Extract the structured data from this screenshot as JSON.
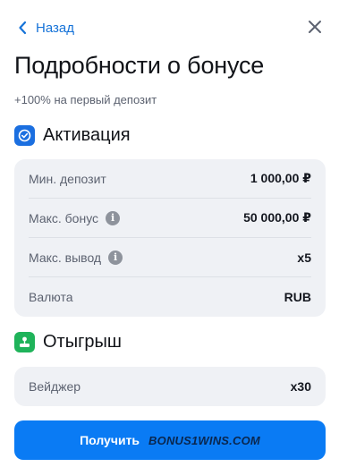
{
  "header": {
    "back_label": "Назад",
    "title": "Подробности о бонусе",
    "subtitle": "+100% на первый депозит"
  },
  "activation": {
    "title": "Активация",
    "icon": "check-badge-icon",
    "rows": [
      {
        "label": "Мин. депозит",
        "value": "1 000,00 ₽",
        "info": false
      },
      {
        "label": "Макс. бонус",
        "value": "50 000,00 ₽",
        "info": true
      },
      {
        "label": "Макс. вывод",
        "value": "x5",
        "info": true
      },
      {
        "label": "Валюта",
        "value": "RUB",
        "info": false
      }
    ]
  },
  "wagering": {
    "title": "Отыгрыш",
    "icon": "joystick-icon",
    "rows": [
      {
        "label": "Вейджер",
        "value": "x30"
      }
    ]
  },
  "cta": {
    "label": "Получить"
  },
  "watermark": "BONUS1WINS.COM",
  "colors": {
    "accent": "#0a7bf4",
    "link": "#1673d8",
    "activation_badge": "#1b6fe0",
    "wagering_badge": "#1fb35a",
    "card_bg": "#eff1f5"
  }
}
